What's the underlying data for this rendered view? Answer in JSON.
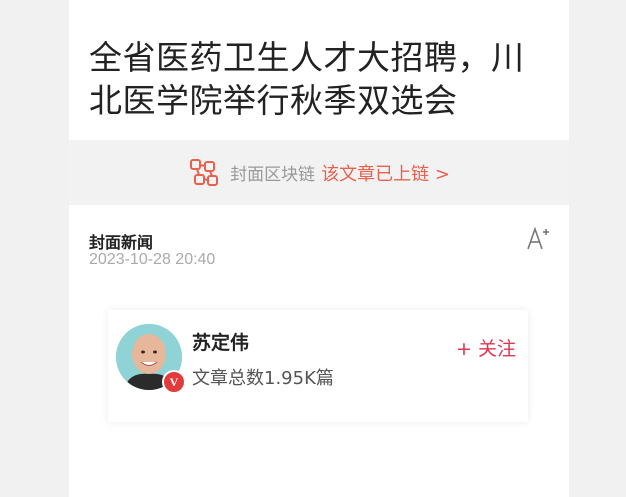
{
  "article": {
    "title": "全省医药卫生人才大招聘，川北医学院举行秋季双选会",
    "source": "封面新闻",
    "datetime": "2023-10-28 20:40"
  },
  "chain": {
    "icon": "blockchain-icon",
    "label": "封面区块链",
    "link_text": "该文章已上链 >",
    "link_color": "#e8614f"
  },
  "toolbar": {
    "font_size_icon": "font-size-increase-icon"
  },
  "author": {
    "name": "苏定伟",
    "stats": "文章总数1.95K篇",
    "badge": "V",
    "follow_label": "+ 关注",
    "follow_color": "#e0344f"
  }
}
